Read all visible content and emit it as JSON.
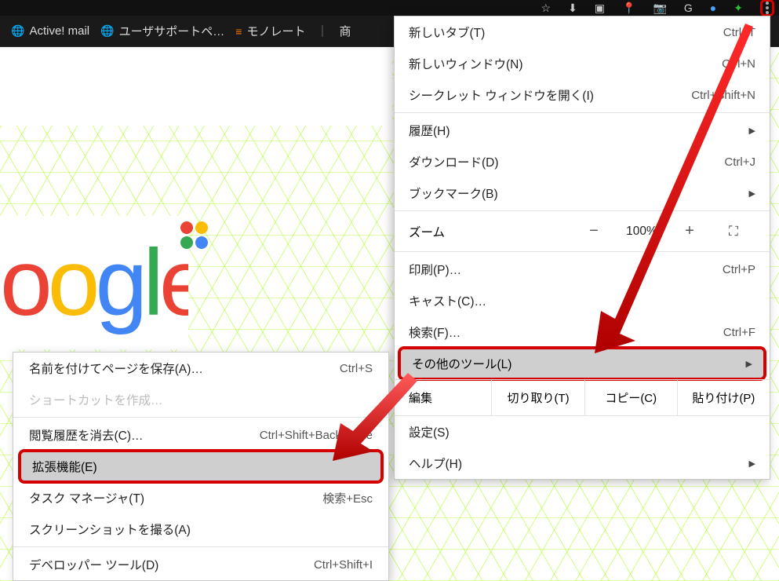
{
  "bookmarks": {
    "items": [
      {
        "label": "Active! mail"
      },
      {
        "label": "ユーザサポートペ…"
      },
      {
        "label": "モノレート"
      },
      {
        "label": "商"
      }
    ],
    "separator": "｜"
  },
  "mainMenu": {
    "newTab": {
      "label": "新しいタブ(T)",
      "shortcut": "Ctrl+T"
    },
    "newWindow": {
      "label": "新しいウィンドウ(N)",
      "shortcut": "Ctrl+N"
    },
    "incognito": {
      "label": "シークレット ウィンドウを開く(I)",
      "shortcut": "Ctrl+Shift+N"
    },
    "history": {
      "label": "履歴(H)"
    },
    "downloads": {
      "label": "ダウンロード(D)",
      "shortcut": "Ctrl+J"
    },
    "bookmarks": {
      "label": "ブックマーク(B)"
    },
    "zoom": {
      "label": "ズーム",
      "value": "100%",
      "minus": "−",
      "plus": "+"
    },
    "print": {
      "label": "印刷(P)…",
      "shortcut": "Ctrl+P"
    },
    "cast": {
      "label": "キャスト(C)…"
    },
    "find": {
      "label": "検索(F)…",
      "shortcut": "Ctrl+F"
    },
    "moreTools": {
      "label": "その他のツール(L)"
    },
    "edit": {
      "label": "編集",
      "cut": "切り取り(T)",
      "copy": "コピー(C)",
      "paste": "貼り付け(P)"
    },
    "settings": {
      "label": "設定(S)"
    },
    "help": {
      "label": "ヘルプ(H)"
    }
  },
  "subMenu": {
    "savePage": {
      "label": "名前を付けてページを保存(A)…",
      "shortcut": "Ctrl+S"
    },
    "createShortcut": {
      "label": "ショートカットを作成…"
    },
    "clearHistory": {
      "label": "閲覧履歴を消去(C)…",
      "shortcut": "Ctrl+Shift+Backspace"
    },
    "extensions": {
      "label": "拡張機能(E)"
    },
    "taskManager": {
      "label": "タスク マネージャ(T)",
      "shortcut": "検索+Esc"
    },
    "screenshot": {
      "label": "スクリーンショットを撮る(A)"
    },
    "devTools": {
      "label": "デベロッパー ツール(D)",
      "shortcut": "Ctrl+Shift+I"
    }
  },
  "icons": {
    "star": "☆",
    "download": "⬇",
    "office": "▣",
    "pin": "📍",
    "camera": "📷",
    "g": "G",
    "ball": "●",
    "puzzle": "✦",
    "globe": "🌐",
    "mono": "≡",
    "triangle": "▶"
  }
}
